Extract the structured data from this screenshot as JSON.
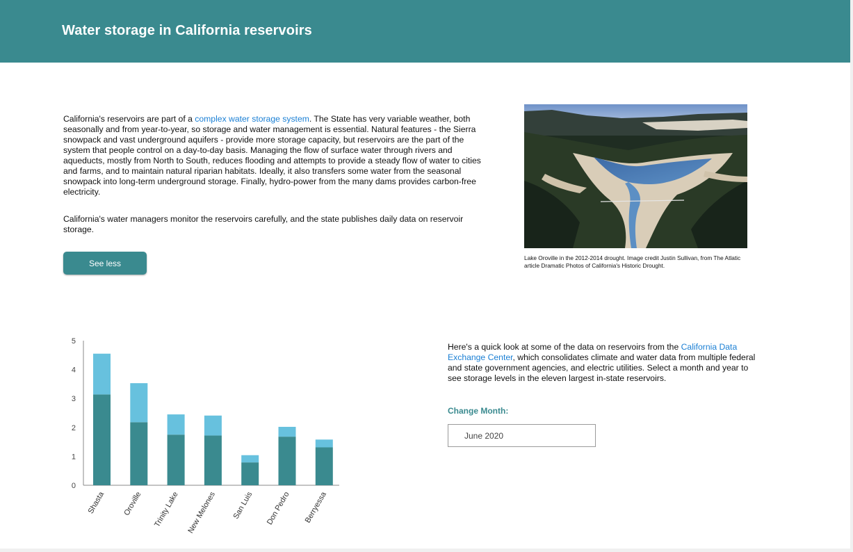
{
  "header": {
    "title": "Water storage in California reservoirs"
  },
  "intro": {
    "p1_before": "California's reservoirs are part of a ",
    "p1_link": "complex water storage system",
    "p1_after": ". The State has very variable weather, both seasonally and from year-to-year, so storage and water management is essential. Natural features - the Sierra snowpack and vast underground aquifers - provide more storage capacity, but reservoirs are the part of the system that people control on a day-to-day basis. Managing the flow of surface water through rivers and aqueducts, mostly from North to South, reduces flooding and attempts to provide a steady flow of water to cities and farms, and to maintain natural riparian habitats. Ideally, it also transfers some water from the seasonal snowpack into long-term underground storage. Finally, hydro-power from the many dams provides carbon-free electricity.",
    "p2": "California's water managers monitor the reservoirs carefully, and the state publishes daily data on reservoir storage.",
    "toggle_label": "See less"
  },
  "photo": {
    "caption": "Lake Oroville in the 2012-2014 drought. Image credit Justin Sullivan, from The Atlatic article Dramatic Photos of California's Historic Drought."
  },
  "blurb": {
    "before": "Here's a quick look at some of the data on reservoirs from the ",
    "link": "California Data Exchange Center",
    "after": ", which consolidates climate and water data from multiple federal and state government agencies, and electric utilities. Select a month and year to see storage levels in the eleven largest in-state reservoirs."
  },
  "month_control": {
    "label": "Change Month:",
    "value": "June 2020"
  },
  "colors": {
    "teal": "#3a8a8f",
    "light_blue": "#67c1de",
    "link": "#1a7fd4"
  },
  "chart_data": {
    "type": "bar",
    "stacked": true,
    "categories": [
      "Shasta",
      "Oroville",
      "Trinity Lake",
      "New Melones",
      "San Luis",
      "Don Pedro",
      "Berryessa"
    ],
    "series": [
      {
        "values": [
          3.14,
          2.18,
          1.75,
          1.72,
          0.79,
          1.68,
          1.31
        ],
        "color": "#3a8a8f"
      },
      {
        "values": [
          1.41,
          1.35,
          0.7,
          0.69,
          0.25,
          0.34,
          0.27
        ],
        "color": "#67c1de"
      }
    ],
    "yticks": [
      0,
      1,
      2,
      3,
      4,
      5
    ],
    "ylim": [
      0,
      5
    ],
    "grid": false
  }
}
